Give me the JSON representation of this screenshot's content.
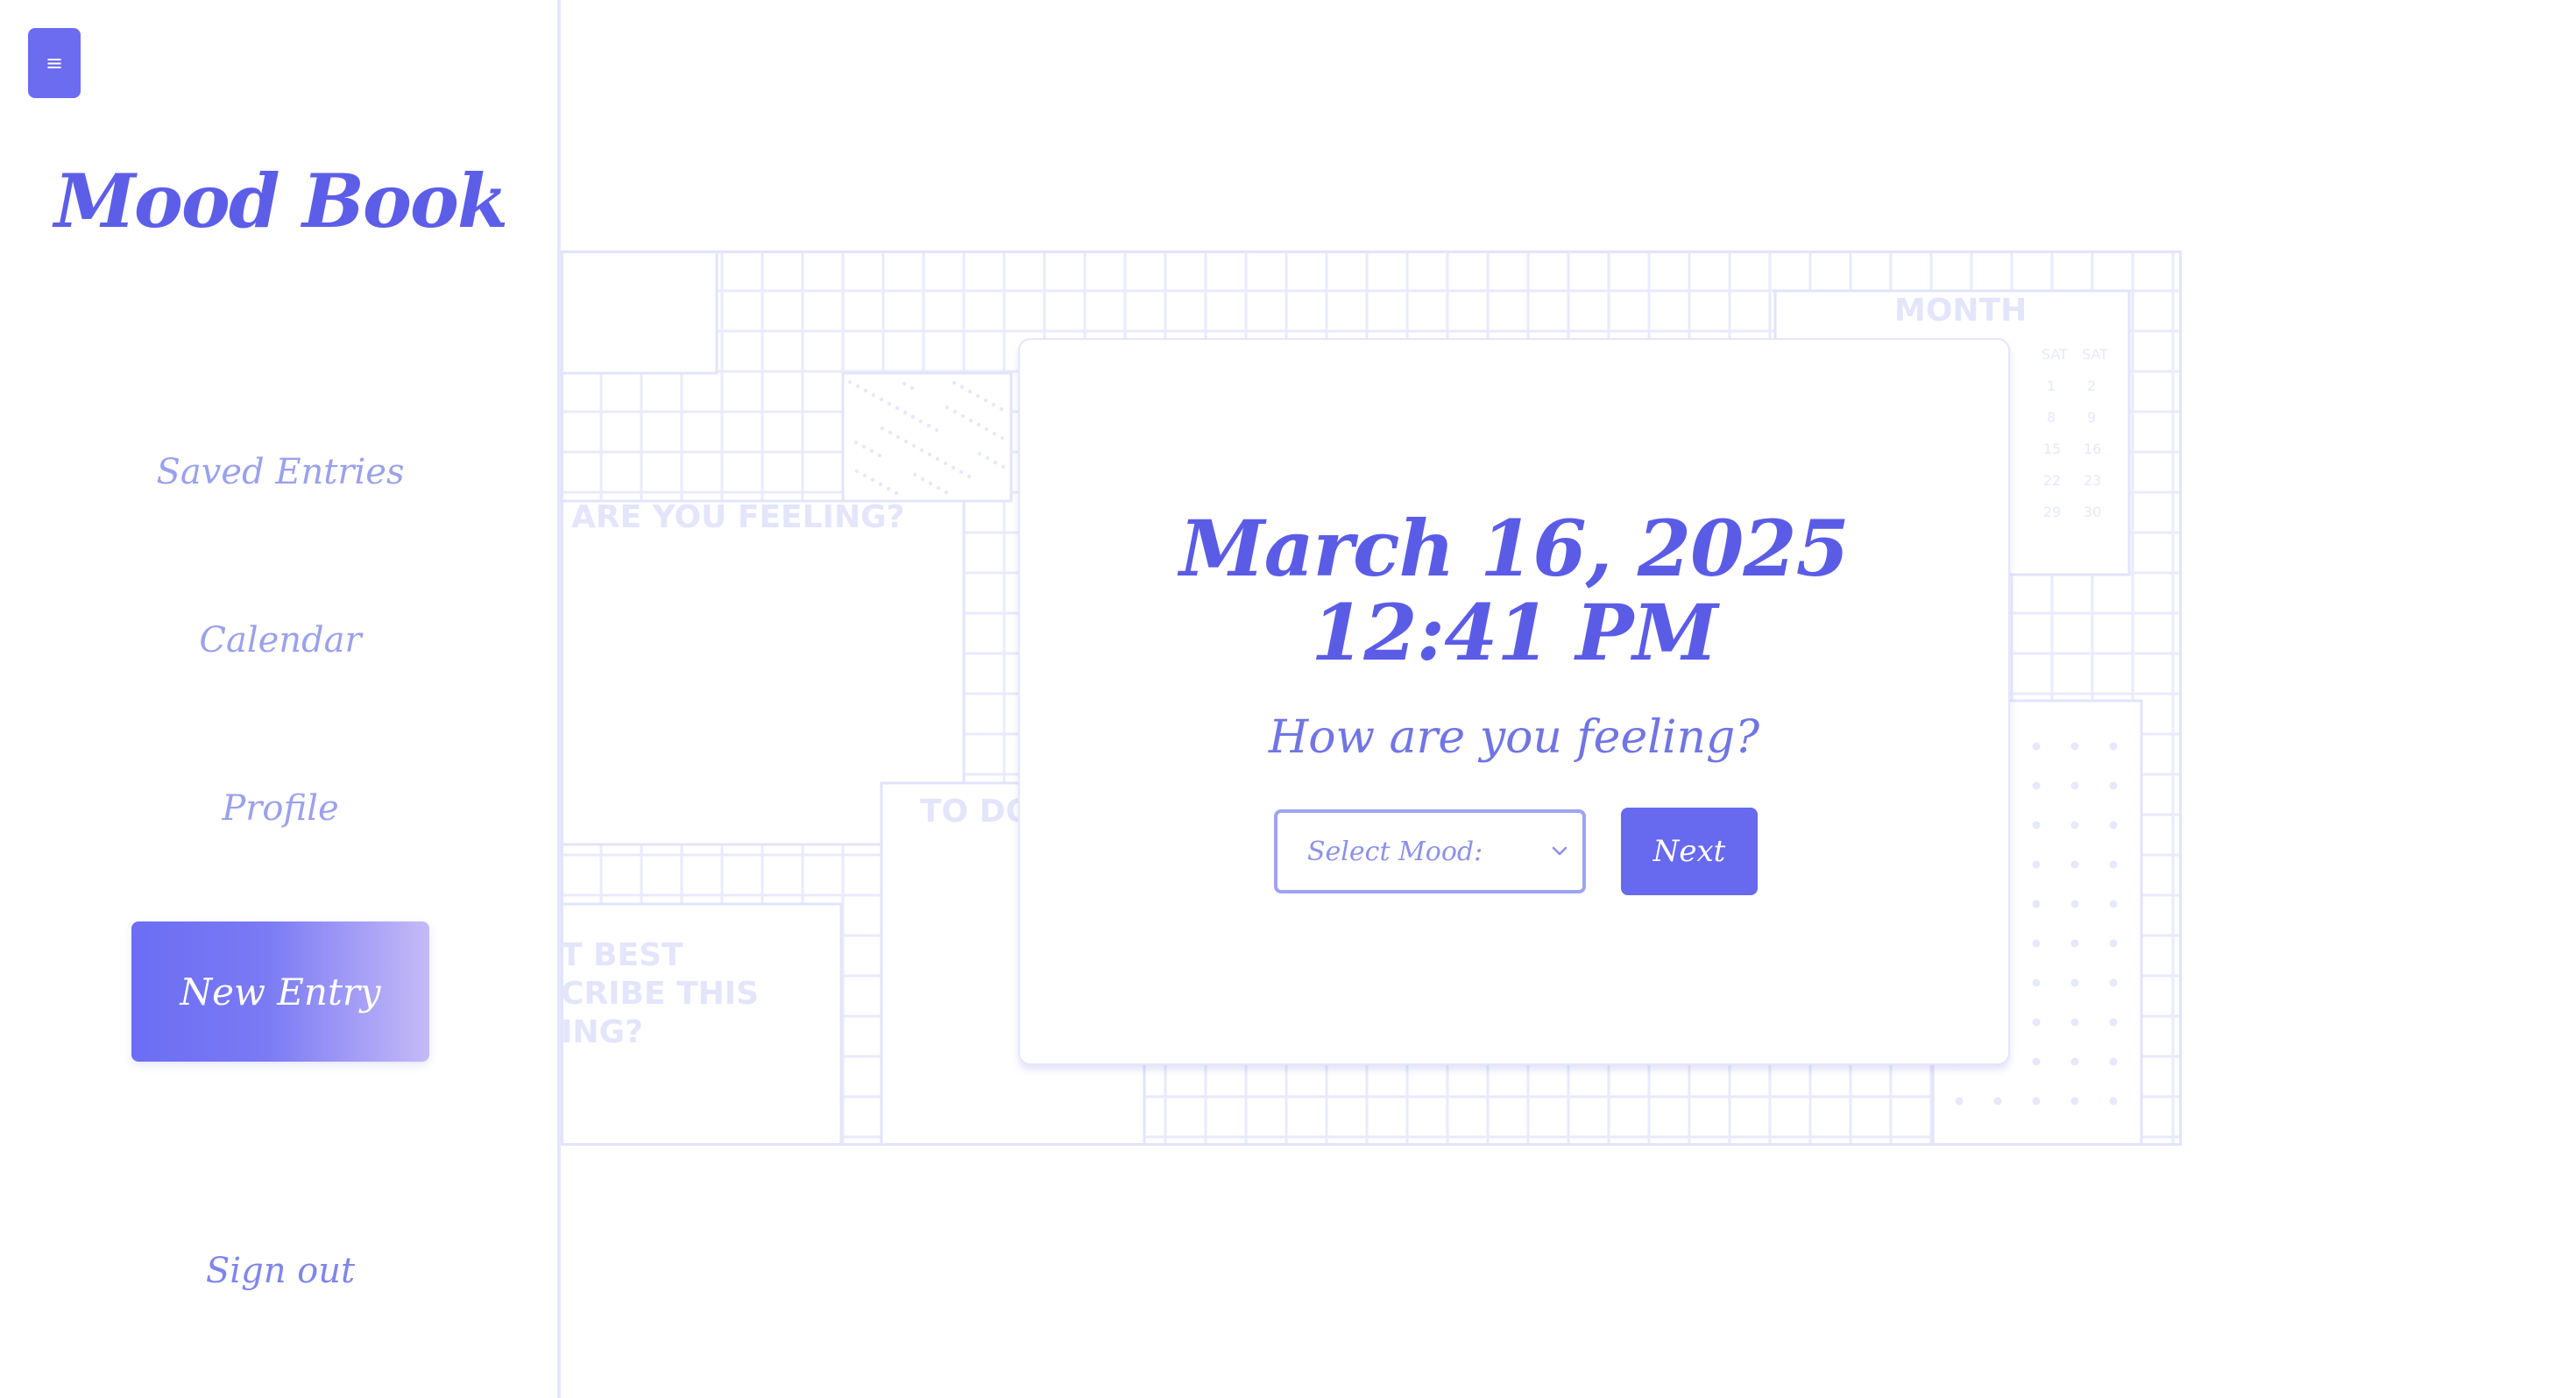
{
  "app": {
    "menu_icon": "≡",
    "brand": "Mood Book"
  },
  "sidebar": {
    "items": [
      {
        "label": "Saved Entries"
      },
      {
        "label": "Calendar"
      },
      {
        "label": "Profile"
      },
      {
        "label": "New Entry",
        "active": true
      },
      {
        "label": "Sign out"
      }
    ]
  },
  "background": {
    "texts": [
      "ARE YOU FEELING?",
      "MONTH",
      "TO DO",
      "T BEST",
      "CRIBE THIS",
      "ING?"
    ],
    "calendar_days": [
      "SAT",
      "SAT"
    ],
    "calendar_numbers": [
      "1",
      "2",
      "8",
      "9",
      "15",
      "16",
      "22",
      "23",
      "29",
      "30"
    ]
  },
  "entry": {
    "date": "March 16, 2025",
    "time": "12:41 PM",
    "prompt": "How are you feeling?",
    "mood_select": {
      "value": "Select Mood:"
    },
    "next_label": "Next"
  },
  "colors": {
    "accent": "#6769ee",
    "brand": "#5d5ee8",
    "nav_text": "#9aa1ec",
    "grid": "#e9eafc",
    "gradient_end": "#c5baf7"
  },
  "icons": {
    "menu": "hamburger-menu-icon",
    "select": "chevron-down-icon"
  }
}
